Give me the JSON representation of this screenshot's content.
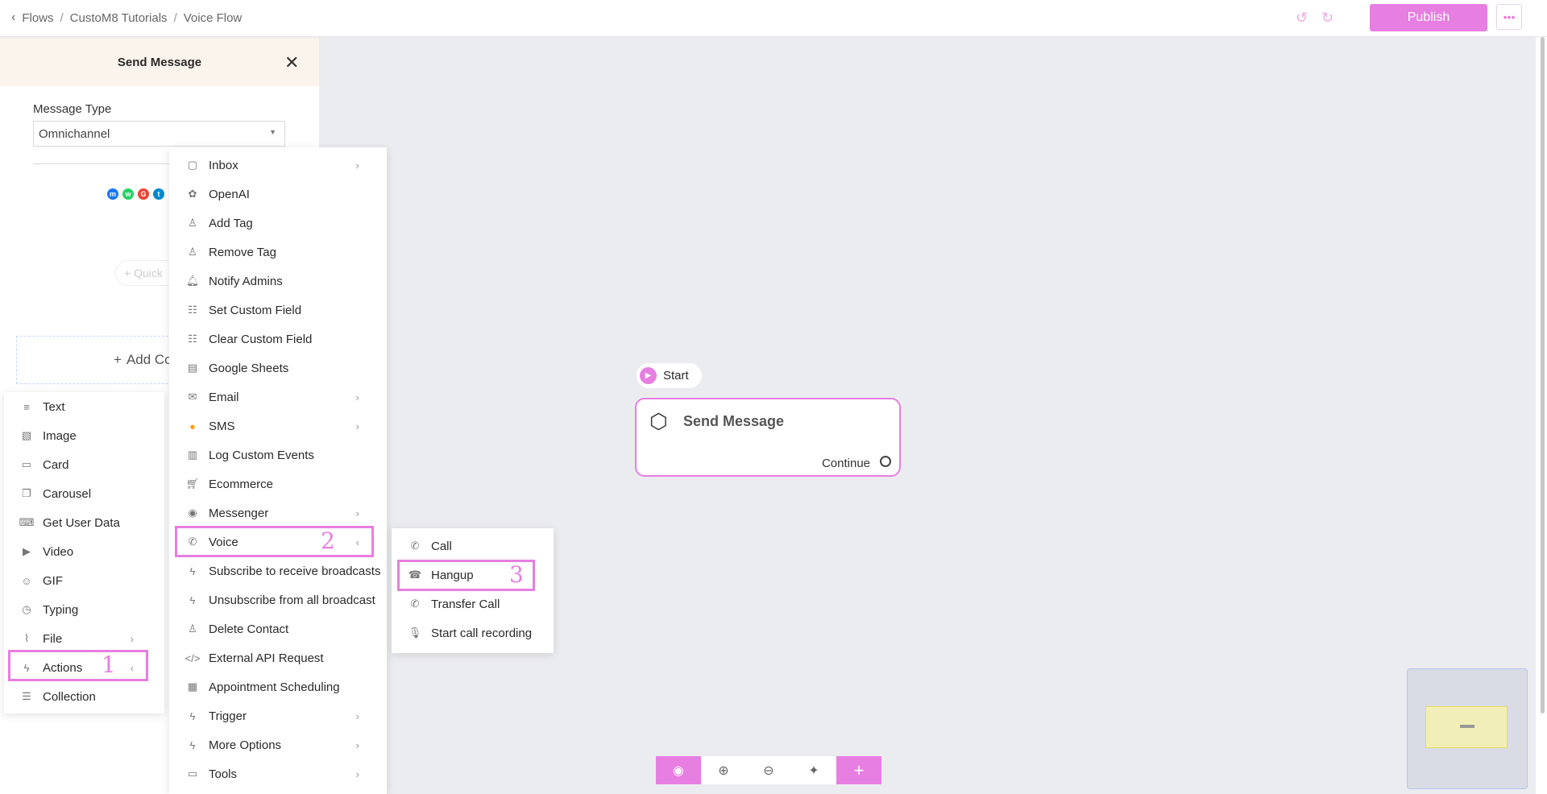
{
  "breadcrumb": {
    "items": [
      "Flows",
      "CustoM8 Tutorials",
      "Voice Flow"
    ]
  },
  "header": {
    "publish_label": "Publish",
    "more_label": "•••"
  },
  "panel": {
    "title": "Send Message",
    "message_type_label": "Message Type",
    "message_type_value": "Omnichannel",
    "quick_reply_label": "+ Quick",
    "add_content_label": "Add Co"
  },
  "content_menu": {
    "items": [
      {
        "label": "Text",
        "icon": "text-icon"
      },
      {
        "label": "Image",
        "icon": "image-icon"
      },
      {
        "label": "Card",
        "icon": "card-icon"
      },
      {
        "label": "Carousel",
        "icon": "carousel-icon"
      },
      {
        "label": "Get User Data",
        "icon": "keyboard-icon"
      },
      {
        "label": "Video",
        "icon": "video-icon"
      },
      {
        "label": "GIF",
        "icon": "gif-icon"
      },
      {
        "label": "Typing",
        "icon": "clock-icon"
      },
      {
        "label": "File",
        "icon": "paperclip-icon"
      },
      {
        "label": "Actions",
        "icon": "bolt-icon"
      },
      {
        "label": "Collection",
        "icon": "list-icon"
      }
    ]
  },
  "actions_menu": {
    "items": [
      {
        "label": "Inbox"
      },
      {
        "label": "OpenAI"
      },
      {
        "label": "Add Tag"
      },
      {
        "label": "Remove Tag"
      },
      {
        "label": "Notify Admins"
      },
      {
        "label": "Set Custom Field"
      },
      {
        "label": "Clear Custom Field"
      },
      {
        "label": "Google Sheets"
      },
      {
        "label": "Email"
      },
      {
        "label": "SMS"
      },
      {
        "label": "Log Custom Events"
      },
      {
        "label": "Ecommerce"
      },
      {
        "label": "Messenger"
      },
      {
        "label": "Voice"
      },
      {
        "label": "Subscribe to receive broadcasts"
      },
      {
        "label": "Unsubscribe from all broadcast"
      },
      {
        "label": "Delete Contact"
      },
      {
        "label": "External API Request"
      },
      {
        "label": "Appointment Scheduling"
      },
      {
        "label": "Trigger"
      },
      {
        "label": "More Options"
      },
      {
        "label": "Tools"
      }
    ]
  },
  "voice_menu": {
    "items": [
      {
        "label": "Call"
      },
      {
        "label": "Hangup"
      },
      {
        "label": "Transfer Call"
      },
      {
        "label": "Start call recording"
      }
    ]
  },
  "annotations": {
    "one": "1",
    "two": "2",
    "three": "3"
  },
  "canvas": {
    "start_label": "Start",
    "node_title": "Send Message",
    "node_continue": "Continue"
  },
  "colors": {
    "accent": "#e77ee1",
    "canvas_bg": "#ebecf0"
  }
}
